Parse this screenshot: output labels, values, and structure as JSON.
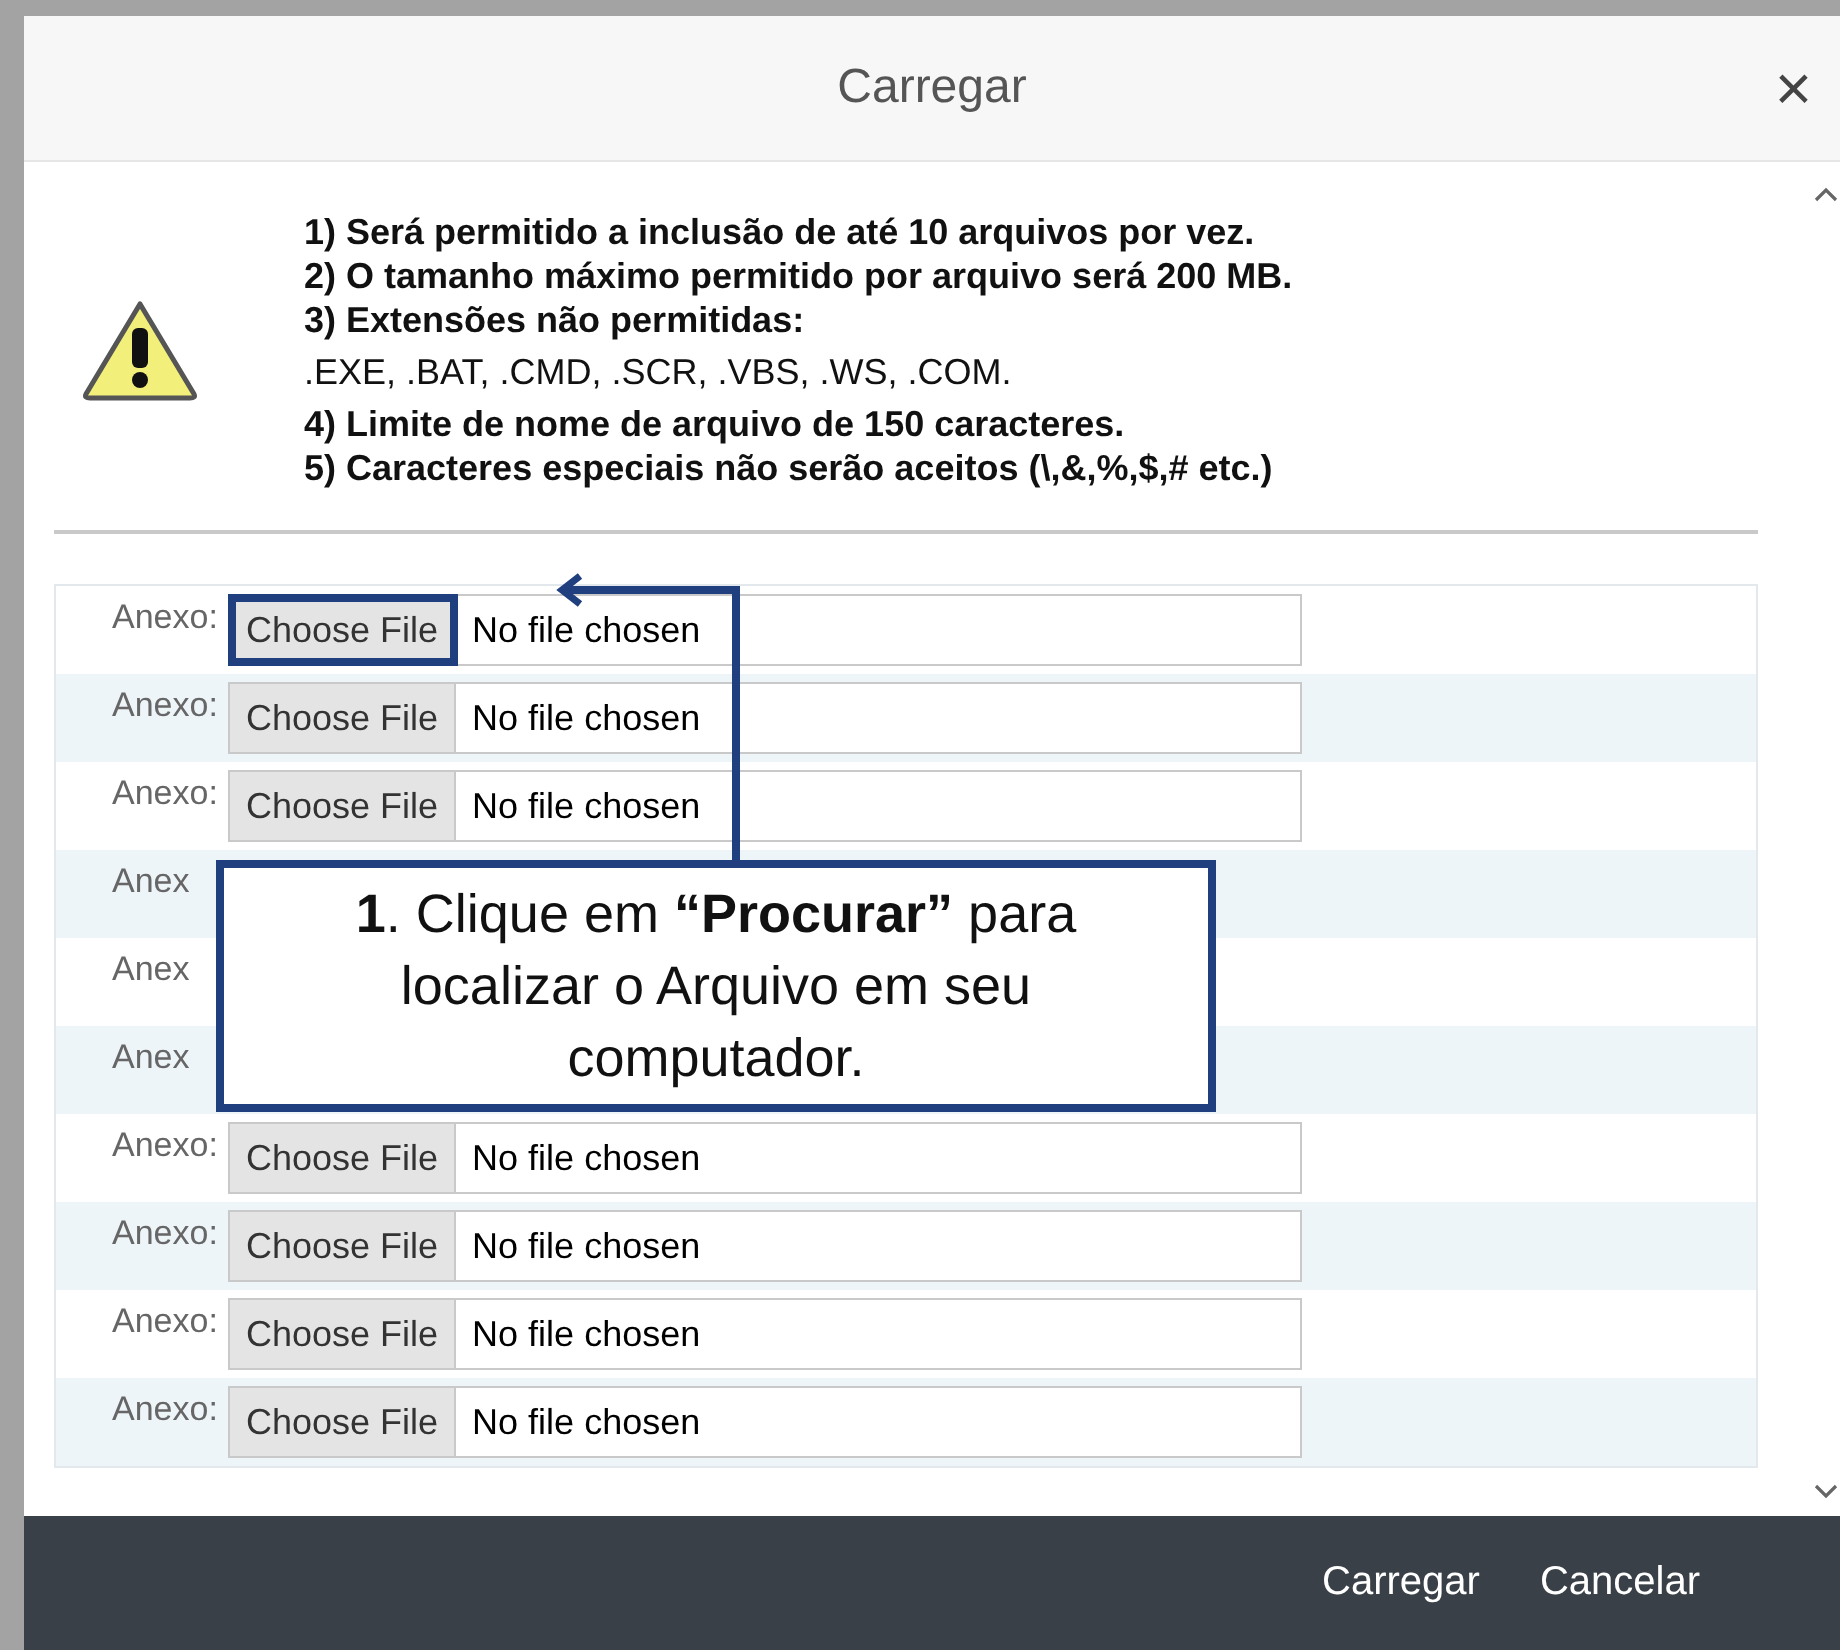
{
  "dialog": {
    "title": "Carregar",
    "close": "×"
  },
  "notice": {
    "lines": [
      {
        "text": "1) Será permitido a inclusão de até 10 arquivos por vez.",
        "bold": true
      },
      {
        "text": "2) O tamanho máximo permitido por arquivo será 200 MB.",
        "bold": true
      },
      {
        "text": "3) Extensões não permitidas:",
        "bold": true
      },
      {
        "text": ".EXE, .BAT, .CMD, .SCR, .VBS, .WS, .COM.",
        "bold": false
      },
      {
        "text": "4) Limite de nome de arquivo de 150 caracteres.",
        "bold": true
      },
      {
        "text": "5) Caracteres especiais não serão aceitos (\\,&,%,$,# etc.)",
        "bold": true
      }
    ]
  },
  "attachments": [
    {
      "kind": "file",
      "label": "Anexo:",
      "button": "Choose File",
      "status": "No file chosen",
      "highlighted": true
    },
    {
      "kind": "file",
      "label": "Anexo:",
      "button": "Choose File",
      "status": "No file chosen",
      "highlighted": false
    },
    {
      "kind": "file",
      "label": "Anexo:",
      "button": "Choose File",
      "status": "No file chosen",
      "highlighted": false
    },
    {
      "kind": "covered",
      "label": "Anex"
    },
    {
      "kind": "covered",
      "label": "Anex"
    },
    {
      "kind": "covered",
      "label": "Anex"
    },
    {
      "kind": "file",
      "label": "Anexo:",
      "button": "Choose File",
      "status": "No file chosen",
      "highlighted": false
    },
    {
      "kind": "file",
      "label": "Anexo:",
      "button": "Choose File",
      "status": "No file chosen",
      "highlighted": false
    },
    {
      "kind": "file",
      "label": "Anexo:",
      "button": "Choose File",
      "status": "No file chosen",
      "highlighted": false
    },
    {
      "kind": "file",
      "label": "Anexo:",
      "button": "Choose File",
      "status": "No file chosen",
      "highlighted": false
    }
  ],
  "callout": {
    "text": "**1**. Clique em **“Procurar”** para localizar o Arquivo em seu computador."
  },
  "footer": {
    "buttons": [
      "Carregar",
      "Cancelar"
    ]
  }
}
